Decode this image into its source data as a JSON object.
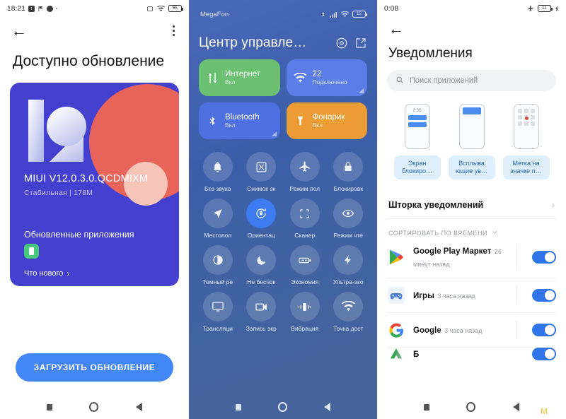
{
  "panel_updater": {
    "status_bar": {
      "time": "18:21",
      "left_icons": [
        "upload-badge-icon",
        "flag-icon",
        "shield-icon",
        "dot-icon"
      ],
      "right_icons": [
        "screenshot-icon",
        "wifi-icon"
      ],
      "battery_level": "55"
    },
    "nav": {
      "back_icon": "back-arrow-icon",
      "menu_icon": "overflow-menu-icon"
    },
    "title": "Доступно обновление",
    "card": {
      "logo": "miui-12-logo",
      "version": "MIUI V12.0.3.0.QCDMIXM",
      "subtitle": "Стабильная | 178M",
      "apps_title": "Обновленные приложения",
      "app_icon": "updated-app-icon",
      "whats_new": "Что нового",
      "whats_new_chevron": "chevron-right-icon"
    },
    "download_button": "ЗАГРУЗИТЬ ОБНОВЛЕНИЕ"
  },
  "panel_control_center": {
    "status_bar": {
      "carrier": "MegaFon",
      "right_icons": [
        "bluetooth-icon",
        "signal-bars-icon",
        "wifi-icon"
      ],
      "battery_level": "12"
    },
    "title": "Центр управле…",
    "header_icons": [
      "settings-gear-icon",
      "edit-icon"
    ],
    "big_tiles": [
      {
        "icon": "data-transfer-icon",
        "label": "Интернет",
        "sub": "Вкл",
        "color": "#6cc072",
        "expandable": false
      },
      {
        "icon": "wifi-icon",
        "label": "22",
        "sub": "Подключено",
        "color": "#5b7de8",
        "expandable": true
      },
      {
        "icon": "bluetooth-icon",
        "label": "Bluetooth",
        "sub": "Вкл",
        "color": "#4d6fe0",
        "expandable": true
      },
      {
        "icon": "flashlight-icon",
        "label": "Фонарик",
        "sub": "Вкл",
        "color": "#eb9c35",
        "expandable": false
      }
    ],
    "grid_tiles": [
      {
        "icon": "bell-icon",
        "label": "Без звука",
        "active": false
      },
      {
        "icon": "screenshot-scissors-icon",
        "label": "Снимок эк",
        "active": false
      },
      {
        "icon": "airplane-icon",
        "label": "Режим пол",
        "active": false
      },
      {
        "icon": "lock-icon",
        "label": "Блокировк",
        "active": false
      },
      {
        "icon": "location-arrow-icon",
        "label": "Местопол",
        "active": false
      },
      {
        "icon": "rotation-lock-icon",
        "label": "Ориентац",
        "active": true
      },
      {
        "icon": "scanner-icon",
        "label": "Сканер",
        "active": false
      },
      {
        "icon": "eye-icon",
        "label": "Режим чте",
        "active": false
      },
      {
        "icon": "dark-mode-icon",
        "label": "Темный ре",
        "active": false
      },
      {
        "icon": "moon-icon",
        "label": "Не беспок",
        "active": false
      },
      {
        "icon": "battery-saver-icon",
        "label": "Экономия",
        "active": false
      },
      {
        "icon": "bolt-icon",
        "label": "Ультра-эко",
        "active": false
      },
      {
        "icon": "cast-icon",
        "label": "Трансляци",
        "active": false
      },
      {
        "icon": "screen-record-icon",
        "label": "Запись экр",
        "active": false
      },
      {
        "icon": "vibration-icon",
        "label": "Вибрация",
        "active": false
      },
      {
        "icon": "hotspot-icon",
        "label": "Точка дост",
        "active": false
      }
    ]
  },
  "panel_notifications": {
    "status_bar": {
      "time": "0:08",
      "right_icons": [
        "airplane-icon",
        "charging-bolt-icon"
      ],
      "battery_level": "11"
    },
    "back_icon": "back-arrow-icon",
    "title": "Уведомления",
    "search": {
      "icon": "search-icon",
      "placeholder": "Поиск приложений",
      "value": ""
    },
    "previews": [
      {
        "preview": "lockscreen-preview",
        "time": "2:36",
        "label": "Экран блокиро…"
      },
      {
        "preview": "popup-preview",
        "label": "Всплыва ющие ув…"
      },
      {
        "preview": "badge-preview",
        "label": "Метка на значке п…"
      }
    ],
    "shade_row": {
      "label": "Шторка уведомлений",
      "chevron": "chevron-right-icon"
    },
    "sort_row": {
      "label": "СОРТИРОВАТЬ ПО ВРЕМЕНИ",
      "chevron": "chevron-down-icon"
    },
    "notifications": [
      {
        "icon": "google-play-icon",
        "name": "Google Play Маркет",
        "time": "26 минут назад",
        "enabled": true
      },
      {
        "icon": "games-gamepad-icon",
        "name": "Игры",
        "time": "3 часа назад",
        "enabled": true
      },
      {
        "icon": "google-g-icon",
        "name": "Google",
        "time": "3 часа назад",
        "enabled": true
      }
    ]
  },
  "navbar": {
    "recents_icon": "recents-square-icon",
    "home_icon": "home-circle-icon",
    "back_icon": "back-triangle-icon"
  },
  "watermark": "M"
}
